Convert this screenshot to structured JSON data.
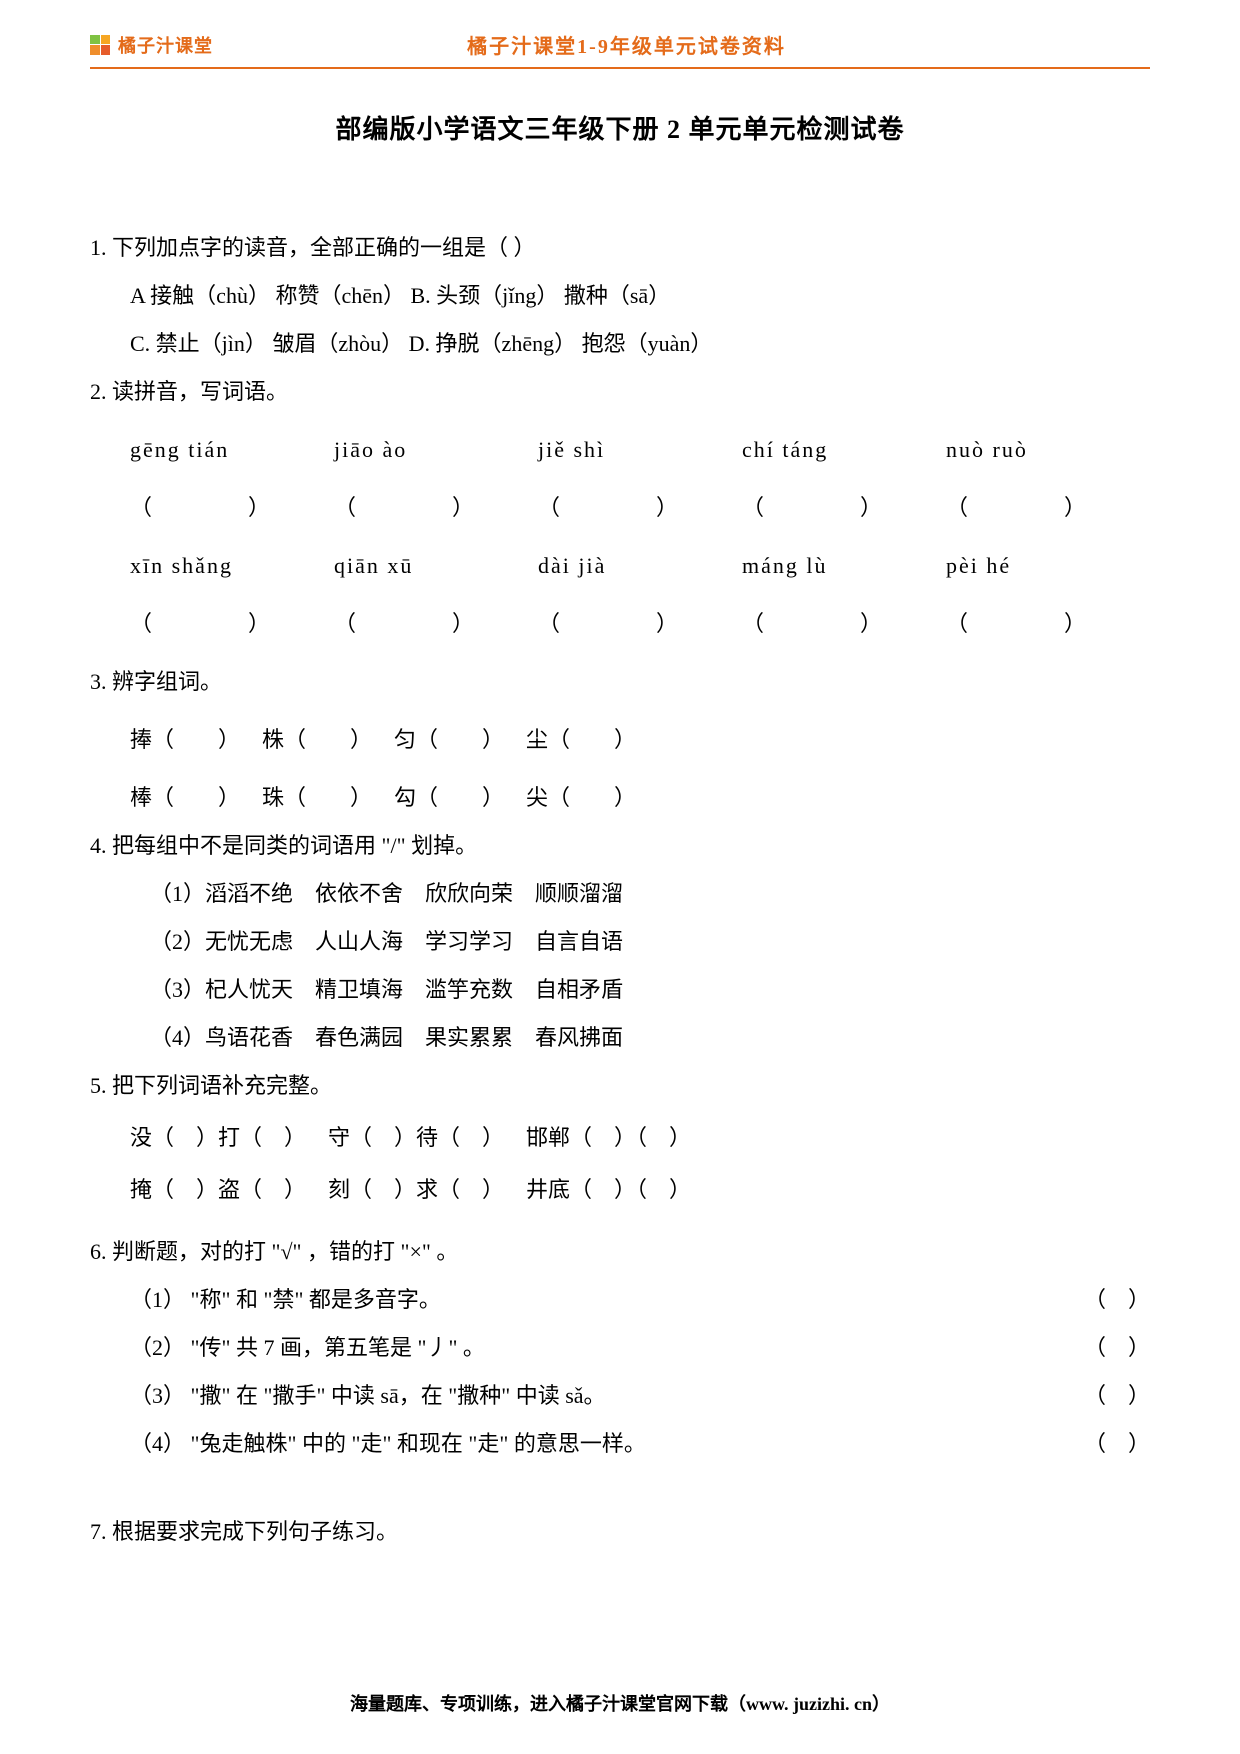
{
  "header": {
    "brand": "橘子汁课堂",
    "title": "橘子汁课堂1-9年级单元试卷资料"
  },
  "main_title": "部编版小学语文三年级下册 2 单元单元检测试卷",
  "q1": {
    "stem": "1. 下列加点字的读音，全部正确的一组是（    ）",
    "optA": "A 接触（chù）    称赞（chēn）      B. 头颈（jǐng）      撒种（sā）",
    "optC": "C. 禁止（jìn）    皱眉（zhòu）     D. 挣脱（zhēng）   抱怨（yuàn）"
  },
  "q2": {
    "stem": "2. 读拼音，写词语。",
    "row1": [
      "gēng tián",
      "jiāo ào",
      "jiě shì",
      "chí táng",
      "nuò ruò"
    ],
    "row2": [
      "xīn shǎng",
      "qiān xū",
      "dài jià",
      "máng lù",
      "pèi hé"
    ]
  },
  "q3": {
    "stem": "3. 辨字组词。",
    "row1": "捧（        ）    株（        ）    匀（        ）    尘（        ）",
    "row2": "棒（        ）    珠（        ）    勾（        ）    尖（        ）"
  },
  "q4": {
    "stem": "4. 把每组中不是同类的词语用 \"/\" 划掉。",
    "g1": "（1）滔滔不绝    依依不舍    欣欣向荣    顺顺溜溜",
    "g2": "（2）无忧无虑    人山人海    学习学习    自言自语",
    "g3": "（3）杞人忧天    精卫填海    滥竽充数    自相矛盾",
    "g4": "（4）鸟语花香    春色满园    果实累累    春风拂面"
  },
  "q5": {
    "stem": "5. 把下列词语补充完整。",
    "row1": "没（    ）打（    ）    守（    ）待（    ）    邯郸（    ）（    ）",
    "row2": "掩（    ）盗（    ）    刻（    ）求（    ）    井底（    ）（    ）"
  },
  "q6": {
    "stem": "6. 判断题，对的打 \"√\" ，错的打 \"×\" 。",
    "j1": "（1） \"称\" 和 \"禁\" 都是多音字。",
    "j2": "（2） \"传\" 共 7 画，第五笔是 \"丿\" 。",
    "j3": "（3） \"撒\" 在 \"撒手\" 中读 sā，在 \"撒种\" 中读 sǎ。",
    "j4": "（4） \"兔走触株\" 中的 \"走\" 和现在 \"走\" 的意思一样。",
    "paren": "（    ）"
  },
  "q7": {
    "stem": "7. 根据要求完成下列句子练习。"
  },
  "footer": "海量题库、专项训练，进入橘子汁课堂官网下载（www. juzizhi. cn）"
}
